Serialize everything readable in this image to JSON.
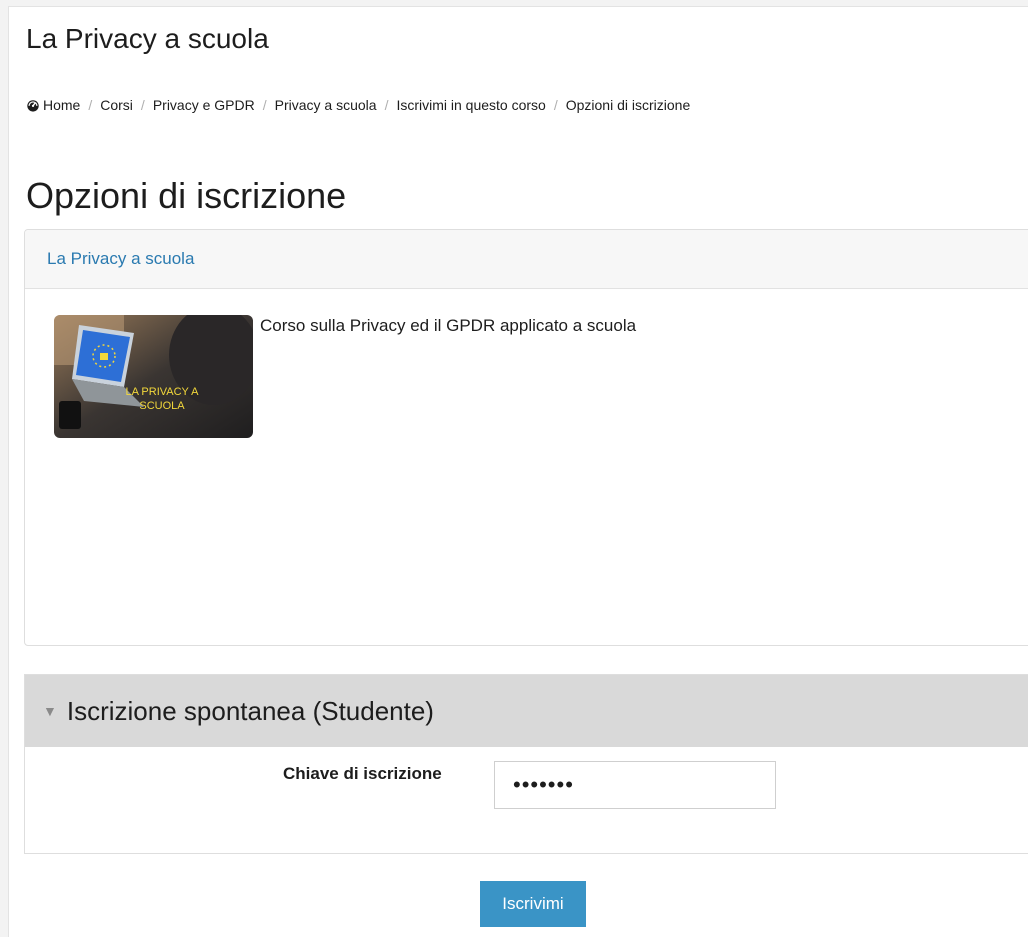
{
  "header": {
    "course_title": "La Privacy a scuola"
  },
  "breadcrumb": {
    "home": "Home",
    "items": [
      "Corsi",
      "Privacy e GPDR",
      "Privacy a scuola",
      "Iscrivimi in questo corso",
      "Opzioni di iscrizione"
    ]
  },
  "page_heading": "Opzioni di iscrizione",
  "course_box": {
    "link": "La Privacy a scuola",
    "image_caption_line1": "LA PRIVACY A",
    "image_caption_line2": "SCUOLA",
    "summary": "Corso sulla Privacy ed il GPDR applicato a scuola"
  },
  "enrolment": {
    "title": "Iscrizione spontanea (Studente)",
    "key_label": "Chiave di iscrizione",
    "key_value": "•••••••",
    "submit_label": "Iscrivimi"
  },
  "colors": {
    "link": "#2a7ab0",
    "button": "#3a94c6",
    "section_header": "#d9d9d9"
  },
  "icons": [
    "home-icon",
    "chevron-down-icon"
  ]
}
